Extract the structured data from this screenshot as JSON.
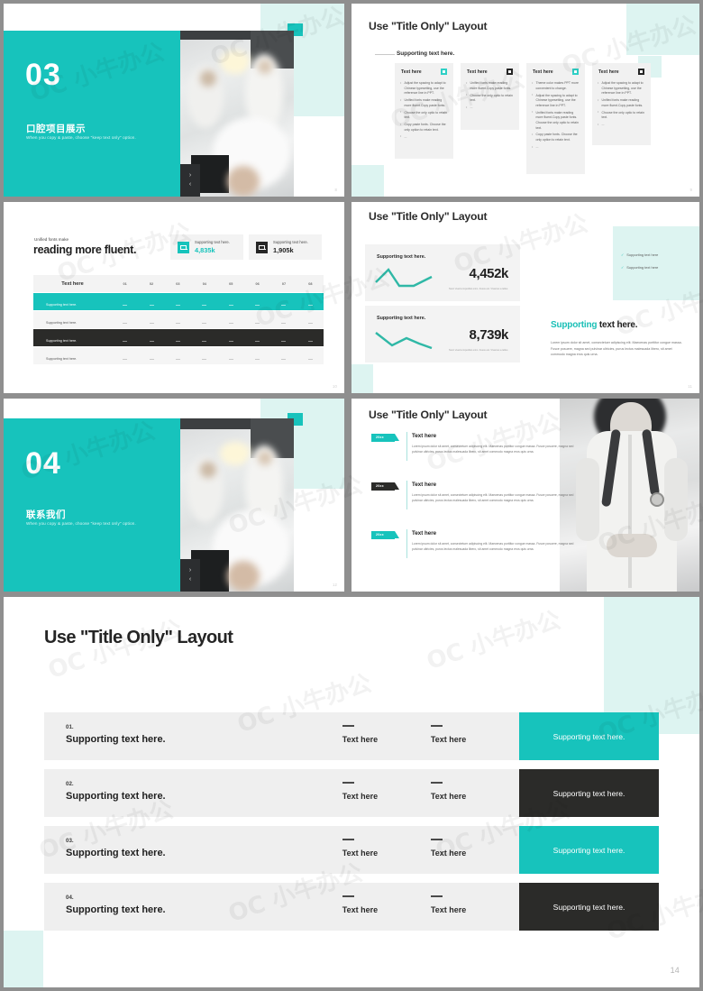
{
  "deck": {
    "accent_teal": "#17c3bc",
    "accent_mint": "#ddf4f1",
    "dark": "#2b2b29",
    "watermark": "OC 小牛办公"
  },
  "slide_section_03": {
    "number": "03",
    "title": "口腔项目展示",
    "subtitle": "When you copy & paste, choose \"keep text only\" option.",
    "arrow_next": "›",
    "arrow_prev": "‹",
    "page": "8"
  },
  "slide_cards": {
    "title": "Use \"Title Only\" Layout",
    "supporting": "Supporting text here.",
    "page": "9",
    "cards": [
      {
        "heading": "Text here",
        "icon": "square-teal-icon",
        "icon_kind": "teal",
        "bullets": [
          "Adjust the spacing to adapt to Chinese typesetting, use the reference line in PPT.",
          "Unified fonts make reading more fluent.Copy paste fonts.",
          "Choose the only optio to retain text.",
          "Copy paste fonts. Choose the only option to retain text.",
          "..."
        ]
      },
      {
        "heading": "Text here",
        "icon": "square-black-icon",
        "icon_kind": "black",
        "bullets": [
          "Unified fonts make reading more fluent.Copy paste fonts.",
          "Choose the only optio to retain text.",
          "..."
        ]
      },
      {
        "heading": "Text here",
        "icon": "square-teal-icon",
        "icon_kind": "teal",
        "bullets": [
          "Theme  color makes PPT more convenient to change.",
          "Adjust the spacing to adapt to Chinese typesetting, use the reference line in PPT.",
          "Unified fonts make reading more fluent.Copy paste fonts. Choose the only optio to retain text.",
          "Copy paste  fonts. Choose the only option to retain text.",
          "..."
        ]
      },
      {
        "heading": "Text here",
        "icon": "square-black-icon",
        "icon_kind": "black",
        "bullets": [
          "Adjust the spacing to adapt to Chinese typesetting, use the reference line in PPT.",
          "Unified fonts make reading more fluent.Copy paste fonts.",
          "Choose the only optio to retain text.",
          "..."
        ]
      }
    ]
  },
  "slide_table": {
    "kicker": "Unified fonts make",
    "headline": "reading more fluent.",
    "page": "10",
    "stats": [
      {
        "icon": "mail-teal-icon",
        "label": "Supporting text here.",
        "value": "4,835k",
        "tone": "teal"
      },
      {
        "icon": "mail-black-icon",
        "label": "Supporting text here.",
        "value": "1,905k",
        "tone": "black"
      }
    ],
    "table": {
      "header": [
        "Text here",
        "01",
        "02",
        "03",
        "04",
        "05",
        "06",
        "07",
        "08"
      ],
      "rows": [
        {
          "label": "Supporting text here.",
          "tone": "teal",
          "cells": [
            "—",
            "—",
            "—",
            "—",
            "—",
            "—",
            "—",
            "—"
          ]
        },
        {
          "label": "Supporting text here.",
          "tone": "gray",
          "cells": [
            "—",
            "—",
            "—",
            "—",
            "—",
            "—",
            "—",
            "—"
          ]
        },
        {
          "label": "Supporting text here.",
          "tone": "dark",
          "cells": [
            "—",
            "—",
            "—",
            "—",
            "—",
            "—",
            "—",
            "—"
          ]
        },
        {
          "label": "Supporting text here.",
          "tone": "gray",
          "cells": [
            "—",
            "—",
            "—",
            "—",
            "—",
            "—",
            "—",
            "—"
          ]
        }
      ]
    }
  },
  "slide_kpi": {
    "title": "Use \"Title Only\" Layout",
    "page": "11",
    "kpis": [
      {
        "label": "Supporting text here.",
        "value": "4,452k",
        "footnote": "Nunc viverra imperdiet enim. Fusce est. Vivamus a tellus."
      },
      {
        "label": "Supporting text here.",
        "value": "8,739k",
        "footnote": "Nunc viverra imperdiet enim. Fusce est. Vivamus a tellus."
      }
    ],
    "checks": [
      "Supporting text here",
      "Supporting text here"
    ],
    "lead_accent": "Supporting",
    "lead_rest": " text here.",
    "body": "Lorem ipsum dolor sit amet, consectetuer adipiscing elit. Maecenas porttitor congue massa. Fusce posuere, magna sed pulvinar ultricies, purus lectus malesuada libero, sit amet commodo magna eros quis urna."
  },
  "slide_section_04": {
    "number": "04",
    "title": "联系我们",
    "subtitle": "When you copy & paste, choose \"keep text only\" option.",
    "arrow_next": "›",
    "arrow_prev": "‹",
    "page": "12"
  },
  "slide_timeline": {
    "title": "Use \"Title Only\" Layout",
    "page": "13",
    "items": [
      {
        "badge": "20xx",
        "tone": "teal",
        "heading": "Text here",
        "body": "Lorem ipsum dolor sit amet, consectetuer adipiscing elit. Maecenas porttitor congue massa. Fusce posuere, magna sed pulvinar ultricies, purus lectus malesuada libero, sit amet commodo magna eros quis urna."
      },
      {
        "badge": "20xx",
        "tone": "black",
        "heading": "Text here",
        "body": "Lorem ipsum dolor sit amet, consectetuer adipiscing elit. Maecenas porttitor congue massa. Fusce posuere, magna sed pulvinar ultricies, purus lectus malesuada libero, sit amet commodo magna eros quis urna."
      },
      {
        "badge": "20xx",
        "tone": "teal",
        "heading": "Text here",
        "body": "Lorem ipsum dolor sit amet, consectetuer adipiscing elit. Maecenas porttitor congue massa. Fusce posuere, magna sed pulvinar ultricies, purus lectus malesuada libero, sit amet commodo magna eros quis urna."
      }
    ]
  },
  "slide_big": {
    "title": "Use \"Title Only\" Layout",
    "page": "14",
    "rows": [
      {
        "num": "01.",
        "main": "Supporting text here.",
        "col2": "Text here",
        "col3": "Text here",
        "cta": "Supporting text here.",
        "tone": "teal"
      },
      {
        "num": "02.",
        "main": "Supporting text here.",
        "col2": "Text here",
        "col3": "Text here",
        "cta": "Supporting text here.",
        "tone": "black"
      },
      {
        "num": "03.",
        "main": "Supporting text here.",
        "col2": "Text here",
        "col3": "Text here",
        "cta": "Supporting text here.",
        "tone": "teal"
      },
      {
        "num": "04.",
        "main": "Supporting text here.",
        "col2": "Text here",
        "col3": "Text here",
        "cta": "Supporting text here.",
        "tone": "black"
      }
    ]
  }
}
